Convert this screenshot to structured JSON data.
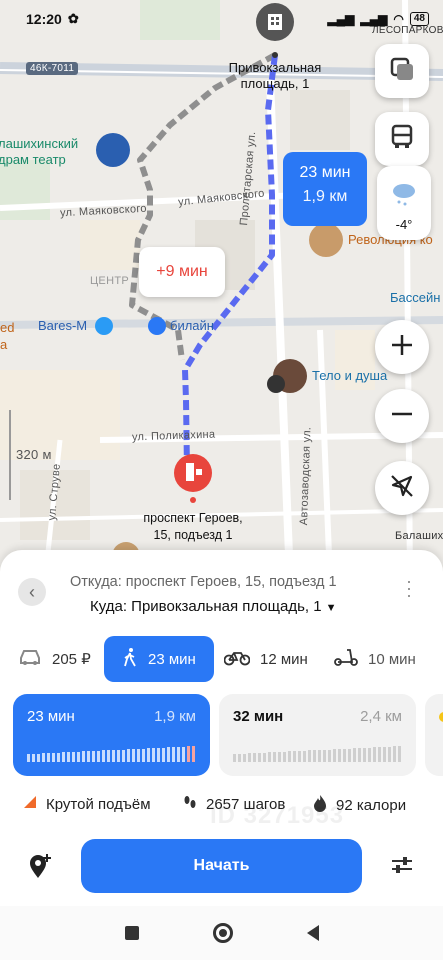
{
  "status": {
    "time": "12:20",
    "battery": "48"
  },
  "map": {
    "road_badge": "46К-7011",
    "station_label": "ЛЕСОПАРКОВАЯ",
    "destination_label": "Привокзальная площадь, 1",
    "theatre_label": "лашихинский драм театр",
    "street_mayakovskogo_1": "ул. Маяковского",
    "street_mayakovskogo_2": "ул. Маяковского",
    "district_label": "ЦЕНТР",
    "bares_label": "Bares-М",
    "beeline_label": "билайн",
    "revolution_label": "Революция ко",
    "pool_label": "Бассейн",
    "telo_label": "Тело и душа",
    "street_polikakhina": "ул. Поликахина",
    "street_proletarskaya": "Пролетарская ул.",
    "street_avtozavodskaya": "Автозаводская ул.",
    "street_struve": "ул. Струве",
    "scale_label": "320 м",
    "balashikha_label": "Балашихин",
    "left_edge_label_1": "ed",
    "left_edge_label_2": "а",
    "start_label_1": "проспект Героев,",
    "start_label_2": "15, подъезд 1",
    "eta_time": "23 мин",
    "eta_dist": "1,9 км",
    "alt_delta": "+9 мин",
    "weather_temp": "-4°"
  },
  "sheet": {
    "from": "Откуда: проспект Героев, 15, подъезд 1",
    "to": "Куда: Привокзальная площадь, 1",
    "modes": {
      "taxi": "205 ₽",
      "walk": "23 мин",
      "bike": "12 мин",
      "scooter": "10 мин"
    },
    "route1": {
      "time": "23 мин",
      "dist": "1,9 км"
    },
    "route2": {
      "time": "32 мин",
      "dist": "2,4 км"
    },
    "stats": {
      "climb": "Крутой подъём",
      "steps": "2657 шагов",
      "calories": "92 калори"
    },
    "start_button": "Начать",
    "watermark": "ID 3271953"
  },
  "colors": {
    "accent": "#2a78f5",
    "alt": "#e8453c"
  }
}
